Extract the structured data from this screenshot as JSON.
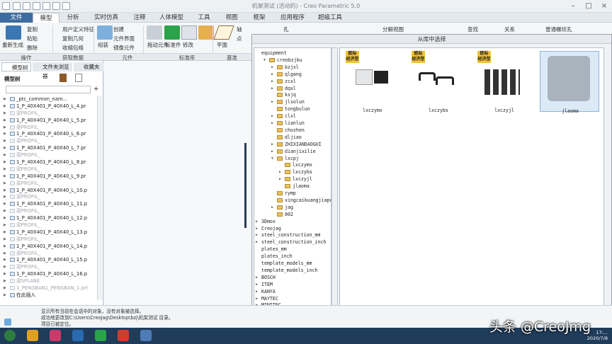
{
  "window": {
    "title": "机架测试 (活动的) - Creo Parametric 5.0"
  },
  "menu": [
    "文件",
    "模型",
    "分析",
    "实时仿真",
    "注释",
    "人体模型",
    "工具",
    "视图",
    "框架",
    "应用程序",
    "超级工具"
  ],
  "ribbon": {
    "regen": "重新生成",
    "copy": "复制",
    "paste": "粘贴",
    "delete": "删除",
    "udf": "用户定义特征",
    "copy_geom": "复制几何",
    "shrinkwrap": "收缩包络",
    "group": "组装",
    "create": "创建",
    "comp_interface": "元件界面",
    "mirror_comp": "镜像元件",
    "drag": "拖动元件",
    "std": "标准件",
    "modify": "修改",
    "plane": "平面",
    "axis": "轴",
    "point": "点",
    "hole": "孔",
    "split_view": "分解视图",
    "orient": "查找",
    "relation": "关系",
    "thread": "普通螺纹孔",
    "groups": [
      "操作",
      "获取数据",
      "元件",
      "标准库",
      "基准"
    ]
  },
  "left_panel": {
    "tabs": [
      "模型树",
      "文件夹浏览器",
      "收藏夹"
    ],
    "header": "模型树",
    "rows": [
      {
        "t": "_ptc_common_nam...",
        "g": false
      },
      {
        "t": "1_P_40X401_P_40X40_L_4.pr",
        "g": false
      },
      {
        "t": "梁PROFIL_",
        "g": true
      },
      {
        "t": "1_P_40X401_P_40X40_L_5.pr",
        "g": false
      },
      {
        "t": "梁PROFIL_",
        "g": true
      },
      {
        "t": "1_P_40X401_P_40X40_L_6.pr",
        "g": false
      },
      {
        "t": "梁PROFIL_",
        "g": true
      },
      {
        "t": "1_P_40X401_P_40X40_L_7.pr",
        "g": false
      },
      {
        "t": "梁PROFIL_",
        "g": true
      },
      {
        "t": "1_P_40X401_P_40X40_L_8.pr",
        "g": false
      },
      {
        "t": "梁PROFIL_",
        "g": true
      },
      {
        "t": "1_P_40X401_P_40X40_L_9.pr",
        "g": false
      },
      {
        "t": "梁PROFIL_",
        "g": true
      },
      {
        "t": "1_P_40X401_P_40X40_L_10.p",
        "g": false
      },
      {
        "t": "梁PROFIL_",
        "g": true
      },
      {
        "t": "1_P_40X401_P_40X40_L_11.p",
        "g": false
      },
      {
        "t": "梁PROFIL_",
        "g": true
      },
      {
        "t": "1_P_40X401_P_40X40_L_12.p",
        "g": false
      },
      {
        "t": "梁PROFIL_",
        "g": true
      },
      {
        "t": "1_P_40X401_P_40X40_L_13.p",
        "g": false
      },
      {
        "t": "梁PROFIL_",
        "g": true
      },
      {
        "t": "1_P_40X401_P_40X40_L_14.p",
        "g": false
      },
      {
        "t": "梁PROFIL_",
        "g": true
      },
      {
        "t": "1_P_40X401_P_40X40_L_15.p",
        "g": false
      },
      {
        "t": "梁PROFIL_",
        "g": true
      },
      {
        "t": "1_P_40X401_P_40X40_L_16.p",
        "g": false
      },
      {
        "t": "梁SPLANE",
        "g": true
      },
      {
        "t": "1_PENGBAN1_PENGBAN_1.prt",
        "g": true
      },
      {
        "t": "在此插入",
        "g": false
      }
    ]
  },
  "dialog": {
    "title": "从库中选择",
    "folders": [
      {
        "t": "equipment",
        "l": 0,
        "e": ""
      },
      {
        "t": "creobzjku",
        "l": 1,
        "e": "▼"
      },
      {
        "t": "bzjxl",
        "l": 2,
        "e": "▶"
      },
      {
        "t": "qlgang",
        "l": 2,
        "e": "▶"
      },
      {
        "t": "zcxl",
        "l": 2,
        "e": "▶"
      },
      {
        "t": "dqxl",
        "l": 2,
        "e": "▶"
      },
      {
        "t": "ksjq",
        "l": 2,
        "e": ""
      },
      {
        "t": "jlsolun",
        "l": 2,
        "e": "▶"
      },
      {
        "t": "tongbulun",
        "l": 2,
        "e": ""
      },
      {
        "t": "clxl",
        "l": 2,
        "e": "▶"
      },
      {
        "t": "lianlun",
        "l": 2,
        "e": "▶"
      },
      {
        "t": "chozhen",
        "l": 2,
        "e": ""
      },
      {
        "t": "dljiao",
        "l": 2,
        "e": ""
      },
      {
        "t": "ZHIXIANDAOGUI",
        "l": 2,
        "e": "▶"
      },
      {
        "t": "dianjixilie",
        "l": 2,
        "e": "▶"
      },
      {
        "t": "lxcpj",
        "l": 2,
        "e": "▼"
      },
      {
        "t": "lxczymx",
        "l": 3,
        "e": ""
      },
      {
        "t": "lxczybs",
        "l": 3,
        "e": "▶"
      },
      {
        "t": "lxczyjl",
        "l": 3,
        "e": "▶"
      },
      {
        "t": "jlaoma",
        "l": 3,
        "e": ""
      },
      {
        "t": "rymp",
        "l": 2,
        "e": ""
      },
      {
        "t": "xingcaikuangjiapeijian",
        "l": 2,
        "e": ""
      },
      {
        "t": "jag",
        "l": 2,
        "e": "▶"
      },
      {
        "t": "002",
        "l": 2,
        "e": ""
      },
      {
        "t": "3Dmox",
        "l": 0,
        "e": "▶"
      },
      {
        "t": "Creojag",
        "l": 0,
        "e": "▶"
      },
      {
        "t": "steel_construction_mm",
        "l": 0,
        "e": "▶"
      },
      {
        "t": "steel_construction_inch",
        "l": 0,
        "e": "▶"
      },
      {
        "t": "plates_mm",
        "l": 0,
        "e": ""
      },
      {
        "t": "plates_inch",
        "l": 0,
        "e": ""
      },
      {
        "t": "template_models_mm",
        "l": 0,
        "e": ""
      },
      {
        "t": "template_models_inch",
        "l": 0,
        "e": ""
      },
      {
        "t": "BOSCH",
        "l": 0,
        "e": "▶"
      },
      {
        "t": "ITEM",
        "l": 0,
        "e": "▶"
      },
      {
        "t": "KANYA",
        "l": 0,
        "e": "▶"
      },
      {
        "t": "MAYTEC",
        "l": 0,
        "e": "▶"
      },
      {
        "t": "MINITEC",
        "l": 0,
        "e": "▶"
      }
    ],
    "items": [
      {
        "name": "lxczymx",
        "badge": "欧标\n经济型"
      },
      {
        "name": "lxczybs",
        "badge": "欧标\n经济型"
      },
      {
        "name": "lxczyjl",
        "badge": "欧标\n经济型"
      },
      {
        "name": "jlaoma",
        "badge": ""
      }
    ]
  },
  "status": {
    "lines": [
      "显示所有当前在会话中的对象，没有对象被选择。",
      "成功地更改到C:\\Users\\CreoJag\\Desktop\\bzj\\机架测试 目录。",
      "项目已被定位。"
    ]
  },
  "watermark": "头条 @CreoJmg",
  "clock": {
    "time": "17:...",
    "date": "2020/7/8"
  },
  "colors": {
    "accent": "#3f6c9e",
    "taskbar": "#1f3c5b",
    "badge": "#f1c232"
  }
}
